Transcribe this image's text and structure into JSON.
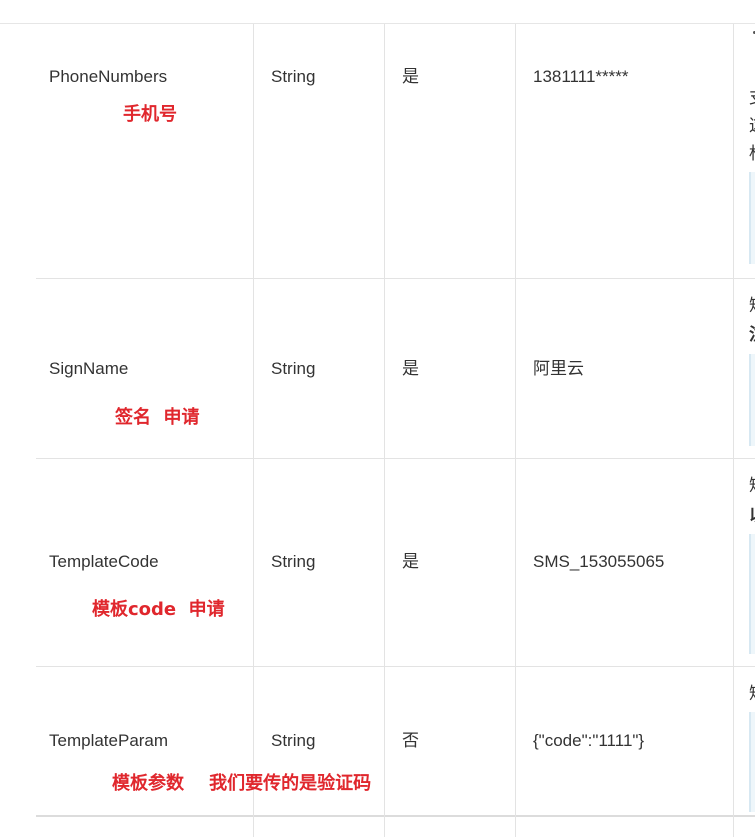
{
  "rows": [
    {
      "name": "PhoneNumbers",
      "type": "String",
      "required": "是",
      "example": "1381111*****",
      "note": "手机号",
      "desc_chars": [
        "支",
        "这",
        "标"
      ]
    },
    {
      "name": "SignName",
      "type": "String",
      "required": "是",
      "example": "阿里云",
      "note": "签名  申请",
      "desc_chars": [
        "短",
        "注"
      ]
    },
    {
      "name": "TemplateCode",
      "type": "String",
      "required": "是",
      "example": "SMS_153055065",
      "note": "模板code  申请",
      "desc_chars": [
        "短",
        "以"
      ]
    },
    {
      "name": "TemplateParam",
      "type": "String",
      "required": "否",
      "example": "{\"code\":\"1111\"}",
      "note": "模板参数    我们要传的是验证码",
      "desc_chars": [
        "短"
      ]
    }
  ]
}
